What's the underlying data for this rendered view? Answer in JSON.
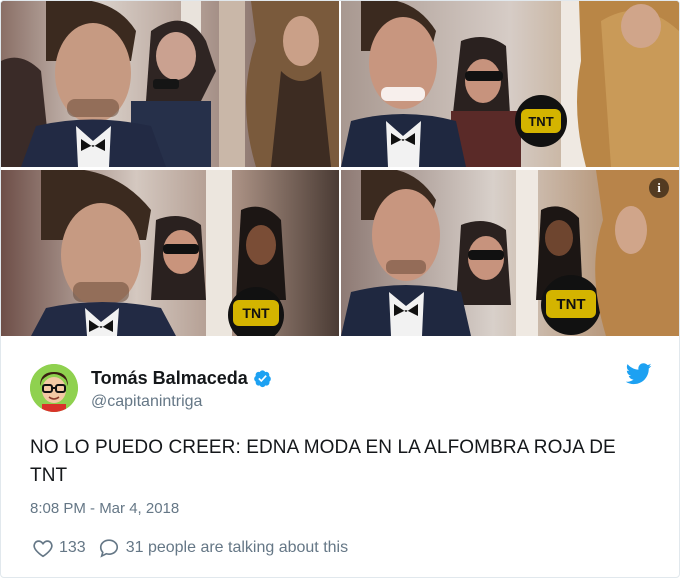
{
  "tweet": {
    "display_name": "Tomás Balmaceda",
    "handle": "@capitanintriga",
    "text": "NO LO PUEDO CREER: EDNA MODA EN LA ALFOMBRA ROJA DE TNT",
    "timestamp": "8:08 PM - Mar 4, 2018",
    "like_count": "133",
    "talk_text": "31 people are talking about this"
  },
  "media": {
    "info_label": "i",
    "microphone_logo": "TNT",
    "photos": [
      "photo-1",
      "photo-2",
      "photo-3",
      "photo-4"
    ]
  },
  "icons": {
    "info": "info-icon",
    "verified": "verified-badge-icon",
    "bird": "twitter-bird-icon",
    "heart": "heart-icon",
    "reply": "speech-bubble-icon"
  },
  "colors": {
    "twitter_blue": "#1da1f2",
    "muted_text": "#657786",
    "body_text": "#14171a",
    "border": "#e1e8ed"
  }
}
